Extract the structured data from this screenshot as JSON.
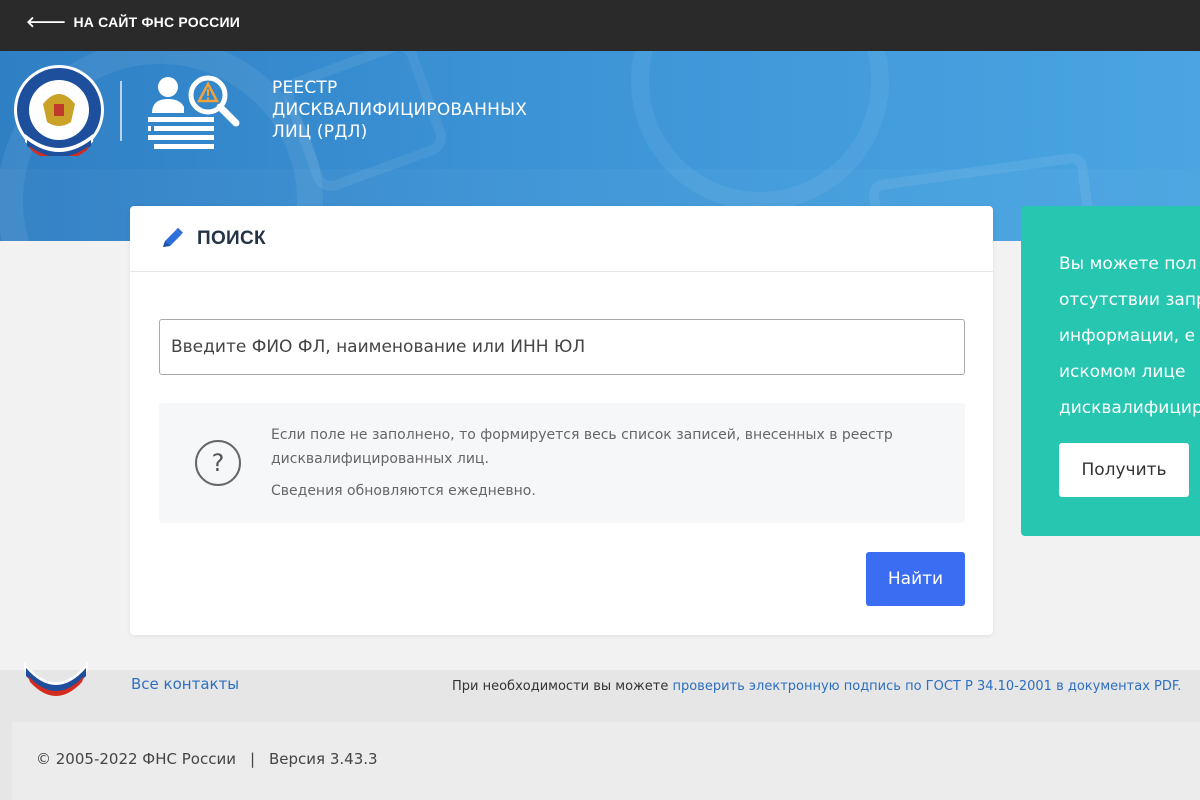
{
  "topbar": {
    "back_label": "НА САЙТ ФНС РОССИИ"
  },
  "header": {
    "title_lines": [
      "РЕЕСТР",
      "ДИСКВАЛИФИЦИРОВАННЫХ",
      "ЛИЦ (РДЛ)"
    ],
    "logo_ring_text": "ФЕДЕРАЛЬНАЯ НАЛОГОВАЯ СЛУЖБА"
  },
  "search": {
    "title": "ПОИСК",
    "input_placeholder": "Введите ФИО ФЛ, наименование или ИНН ЮЛ",
    "input_value": "",
    "info_line1": "Если поле не заполнено, то формируется весь список записей, внесенных в реестр дисквалифицированных лиц.",
    "info_line2": "Сведения обновляются ежедневно.",
    "submit_label": "Найти"
  },
  "side_panel": {
    "text_lines": [
      "Вы можете пол",
      "отсутствии запр",
      "информации, е",
      "искомом лице",
      "дисквалифицир"
    ],
    "button_label": "Получить"
  },
  "footer": {
    "contacts_label": "Все контакты",
    "signature_prefix": "При необходимости вы можете ",
    "signature_link": "проверить электронную подпись по ГОСТ Р 34.10-2001 в документах PDF.",
    "copyright": "© 2005-2022 ФНС России",
    "separator": "|",
    "version": "Версия 3.43.3"
  },
  "colors": {
    "topbar": "#2a2a2a",
    "hero": "#3c94d6",
    "primary_button": "#3b6df2",
    "teal_panel": "#26c6b0",
    "link": "#2d6fc2"
  }
}
